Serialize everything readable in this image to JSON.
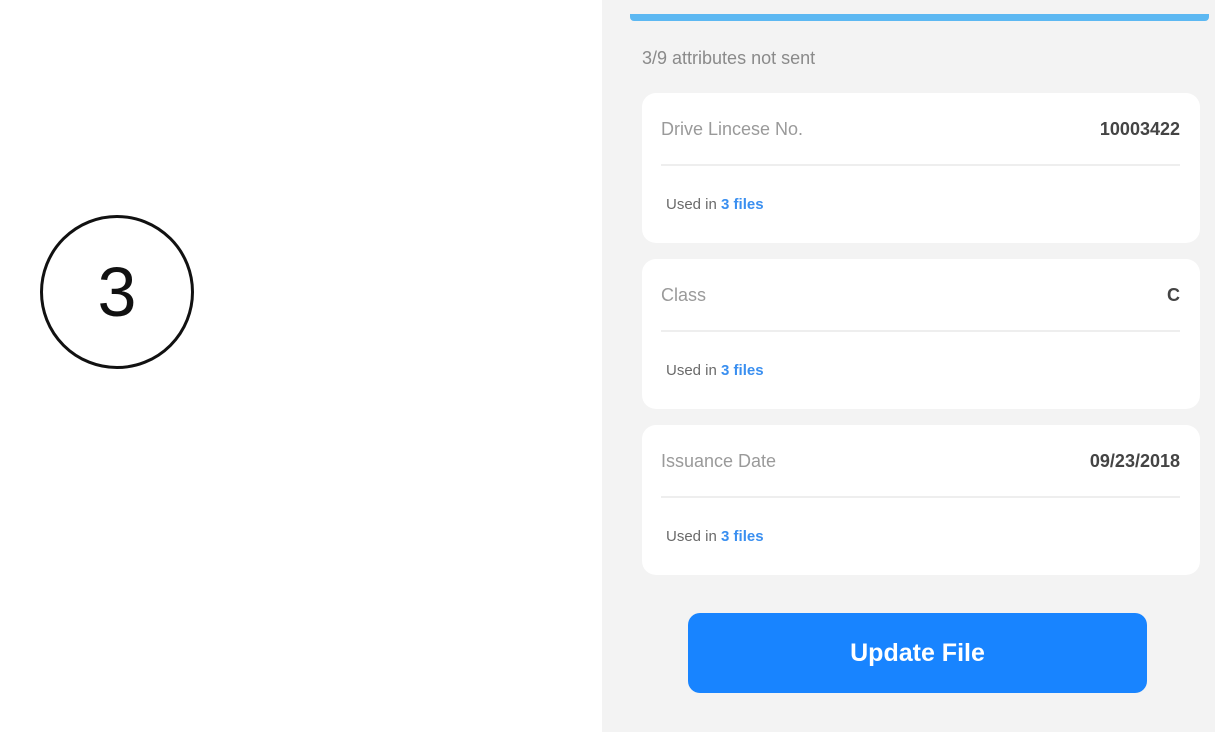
{
  "step": {
    "number": "3"
  },
  "panel": {
    "status_text": "3/9 attributes not sent",
    "attributes": [
      {
        "label": "Drive Lincese No.",
        "value": "10003422",
        "used_prefix": "Used in ",
        "used_link": "3 files"
      },
      {
        "label": "Class",
        "value": "C",
        "used_prefix": "Used in ",
        "used_link": "3 files"
      },
      {
        "label": "Issuance Date",
        "value": "09/23/2018",
        "used_prefix": "Used in ",
        "used_link": "3 files"
      }
    ],
    "update_button_label": "Update File"
  },
  "colors": {
    "accent": "#1884ff",
    "link": "#3a8ff0",
    "panel_background": "#f3f3f3",
    "top_bar": "#5cb8f2"
  }
}
